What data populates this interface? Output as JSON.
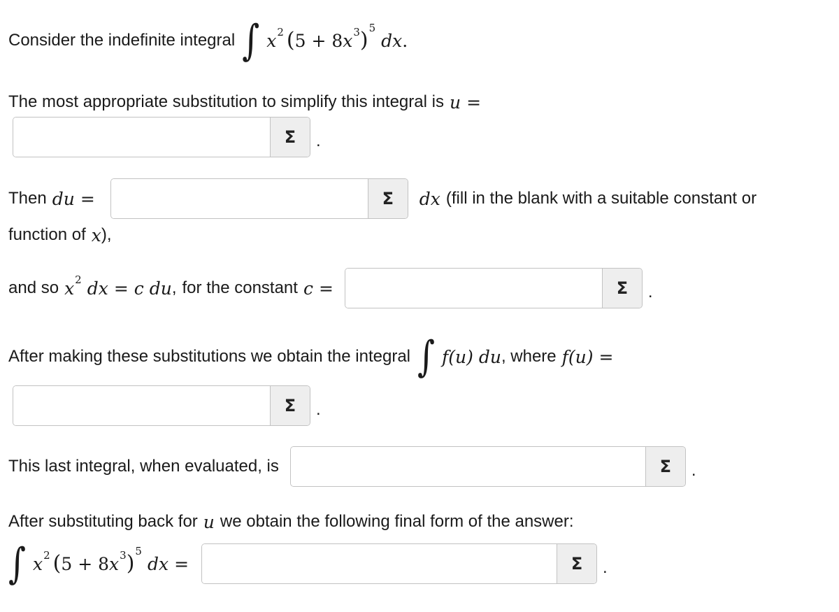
{
  "line1": {
    "text": "Consider the indefinite integral",
    "integral": "∫",
    "x": "x",
    "sq": "2",
    "lparen": "(",
    "five_plus_eight": "5 + 8",
    "x2": "x",
    "cube": "3",
    "rparen": ")",
    "pow5": "5",
    "dx": "dx",
    "period": "."
  },
  "line2": {
    "text": "The most appropriate substitution to simplify this integral is",
    "u": "u",
    "eq": "="
  },
  "line3": {
    "then": "Then",
    "du": "du",
    "eq": "=",
    "dx": "dx",
    "fill": "(fill in the blank with a suitable constant or",
    "fill2": "function of",
    "x": "x",
    "close": "),"
  },
  "line4": {
    "and_so": "and so",
    "x": "x",
    "sq": "2",
    "dx": "dx",
    "eq": "=",
    "cdu": "c du",
    "comma": ",",
    "for_const": "for the constant",
    "c": "c",
    "eq2": "="
  },
  "line5": {
    "text": "After making these substitutions we obtain the integral",
    "integral": "∫",
    "fu": "f(u) du",
    "where": ", where",
    "fu2": "f(u)",
    "eq": "="
  },
  "line6": {
    "text": "This last integral, when evaluated, is"
  },
  "line7": {
    "text": "After substituting back for",
    "u": "u",
    "text2": "we obtain the following final form of the answer:"
  },
  "line8": {
    "integral": "∫",
    "x": "x",
    "sq": "2",
    "lparen": "(",
    "five_plus_eight": "5 + 8",
    "x2": "x",
    "cube": "3",
    "rparen": ")",
    "pow5": "5",
    "dx": "dx",
    "eq": "="
  },
  "answers": {
    "sigma_label": "Σ",
    "period": ".",
    "u_value": "",
    "du_value": "",
    "c_value": "",
    "fu_value": "",
    "eval_value": "",
    "final_value": ""
  }
}
